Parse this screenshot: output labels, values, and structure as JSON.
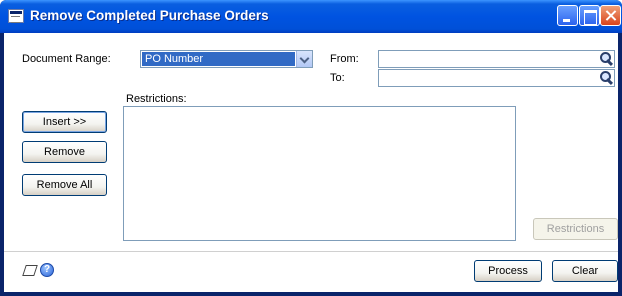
{
  "window": {
    "title": "Remove Completed Purchase Orders",
    "icon": "app-window-icon",
    "controls": [
      "minimize-icon",
      "maximize-icon",
      "close-icon"
    ]
  },
  "form": {
    "document_range_label": "Document Range:",
    "document_range_value": "PO Number",
    "from_label": "From:",
    "to_label": "To:",
    "from_value": "",
    "to_value": "",
    "restrictions_label": "Restrictions:",
    "restrictions_items": []
  },
  "buttons": {
    "insert": "Insert >>",
    "remove": "Remove",
    "remove_all": "Remove All",
    "restrictions": "Restrictions",
    "process": "Process",
    "clear": "Clear"
  },
  "footer": {
    "note_icon": "note-icon",
    "help_icon": "help-icon"
  },
  "colors": {
    "titlebar": "#0053e1",
    "selection": "#316ac5",
    "border": "#7f9db9",
    "disabled_text": "#a0a0a0"
  }
}
